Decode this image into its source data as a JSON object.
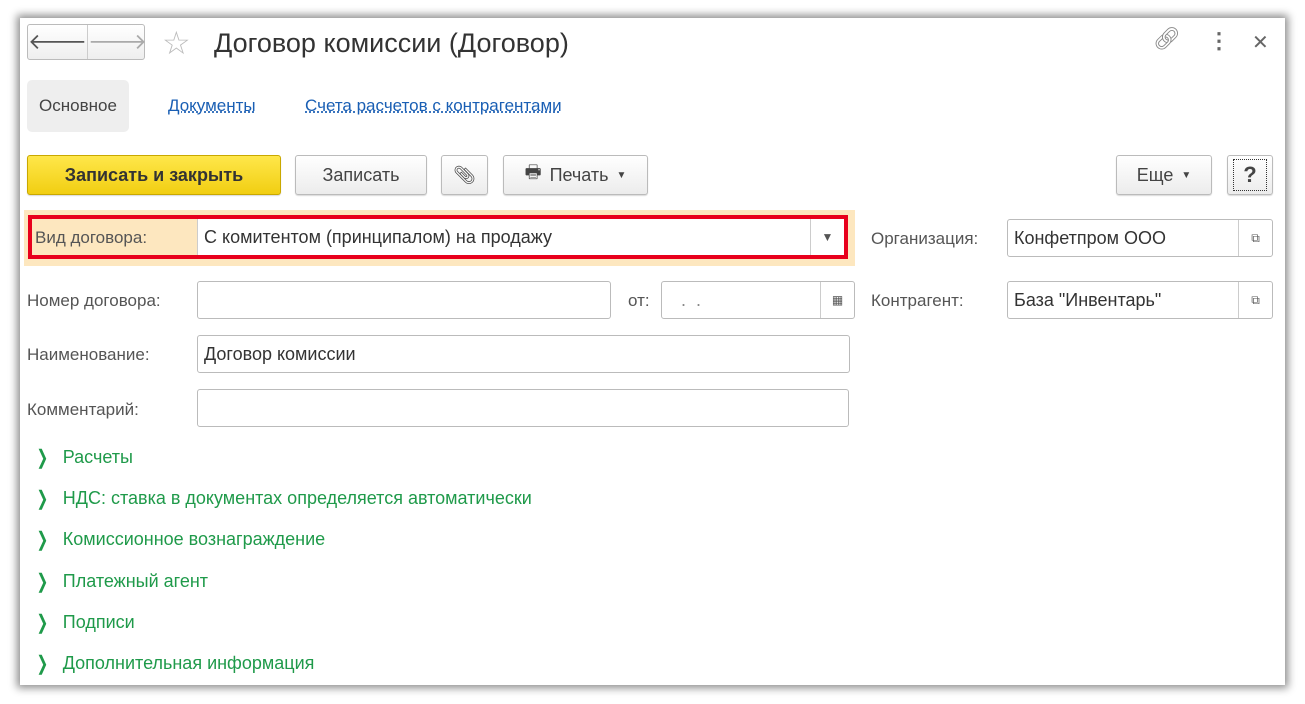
{
  "window": {
    "title": "Договор комиссии (Договор)"
  },
  "nav": {
    "back": "🡐",
    "forward": "🡒"
  },
  "tabs": [
    {
      "label": "Основное"
    },
    {
      "label": "Документы"
    },
    {
      "label": "Счета расчетов с контрагентами"
    }
  ],
  "toolbar": {
    "save_close": "Записать и закрыть",
    "save": "Записать",
    "print": "Печать",
    "more": "Еще",
    "help": "?"
  },
  "form": {
    "contract_type": {
      "label": "Вид договора:",
      "value": "С комитентом (принципалом) на продажу"
    },
    "number": {
      "label": "Номер договора:",
      "value": ""
    },
    "date": {
      "label": "от:",
      "value": " .  . "
    },
    "name": {
      "label": "Наименование:",
      "value": "Договор комиссии"
    },
    "comment": {
      "label": "Комментарий:",
      "value": ""
    },
    "organization": {
      "label": "Организация:",
      "value": "Конфетпром ООО"
    },
    "counterparty": {
      "label": "Контрагент:",
      "value": "База \"Инвентарь\""
    }
  },
  "sections": [
    {
      "label": "Расчеты"
    },
    {
      "label": "НДС: ставка в документах определяется автоматически"
    },
    {
      "label": "Комиссионное вознаграждение"
    },
    {
      "label": "Платежный агент"
    },
    {
      "label": "Подписи"
    },
    {
      "label": "Дополнительная информация"
    }
  ],
  "colors": {
    "primary": "#f5d320",
    "highlight": "#e8001c",
    "link": "#1a5fb4",
    "section": "#1f9a4a"
  }
}
